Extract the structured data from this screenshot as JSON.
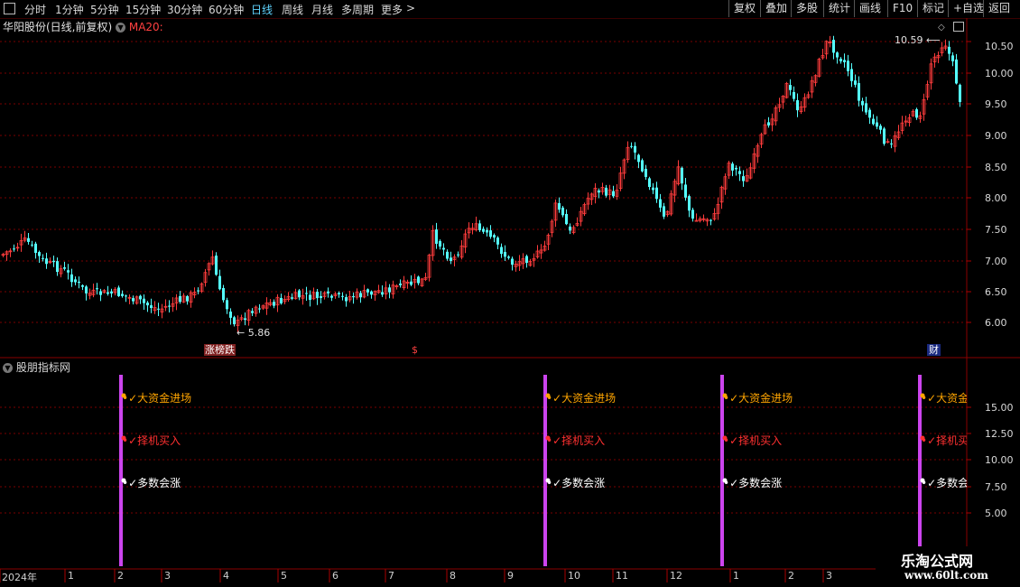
{
  "toolbar": {
    "periods": [
      {
        "label": "分时",
        "active": false
      },
      {
        "label": "1分钟",
        "active": false
      },
      {
        "label": "5分钟",
        "active": false
      },
      {
        "label": "15分钟",
        "active": false
      },
      {
        "label": "30分钟",
        "active": false
      },
      {
        "label": "60分钟",
        "active": false
      },
      {
        "label": "日线",
        "active": true
      },
      {
        "label": "周线",
        "active": false
      },
      {
        "label": "月线",
        "active": false
      },
      {
        "label": "多周期",
        "active": false
      },
      {
        "label": "更多",
        "active": false
      }
    ],
    "more_arrow": ">",
    "buttons": [
      "复权",
      "叠加",
      "多股",
      "统计",
      "画线",
      "F10",
      "标记",
      "+自选",
      "返回"
    ]
  },
  "price_panel": {
    "title": "华阳股份(日线,前复权)",
    "indicator": "MA20:",
    "high_marker": "10.59",
    "low_marker": "5.86",
    "y_ticks": [
      "10.50",
      "10.00",
      "9.50",
      "9.00",
      "8.50",
      "8.00",
      "7.50",
      "7.00",
      "6.50",
      "6.00"
    ],
    "events": [
      {
        "text": "涨榜跌"
      },
      {
        "text": "$"
      },
      {
        "text": "财"
      }
    ]
  },
  "indicator_panel": {
    "title": "股朋指标网",
    "y_ticks": [
      "15.00",
      "12.50",
      "10.00",
      "7.50",
      "5.00"
    ],
    "signals": [
      {
        "label_a": "✓大资金进场",
        "label_b": "✓择机买入",
        "label_c": "✓多数会涨"
      },
      {
        "label_a": "✓大资金进场",
        "label_b": "✓择机买入",
        "label_c": "✓多数会涨"
      },
      {
        "label_a": "✓大资金进场",
        "label_b": "✓择机买入",
        "label_c": "✓多数会涨"
      },
      {
        "label_a": "✓大资金进场",
        "label_b": "✓择机买入",
        "label_c": "✓多数会涨"
      }
    ]
  },
  "date_axis": {
    "labels": [
      "2024年",
      "1",
      "2",
      "3",
      "4",
      "5",
      "6",
      "7",
      "8",
      "9",
      "10",
      "11",
      "12",
      "1",
      "2",
      "3"
    ]
  },
  "watermark": {
    "line1": "乐淘公式网",
    "line2": "www.60lt.com"
  },
  "colors": {
    "up": "#ff3c3c",
    "down": "#54ffff",
    "grid": "#7a0000",
    "signal_bar": "#cc44ee",
    "label_a": "#ffa500",
    "label_b": "#ff3030",
    "label_c": "#ffffff"
  }
}
